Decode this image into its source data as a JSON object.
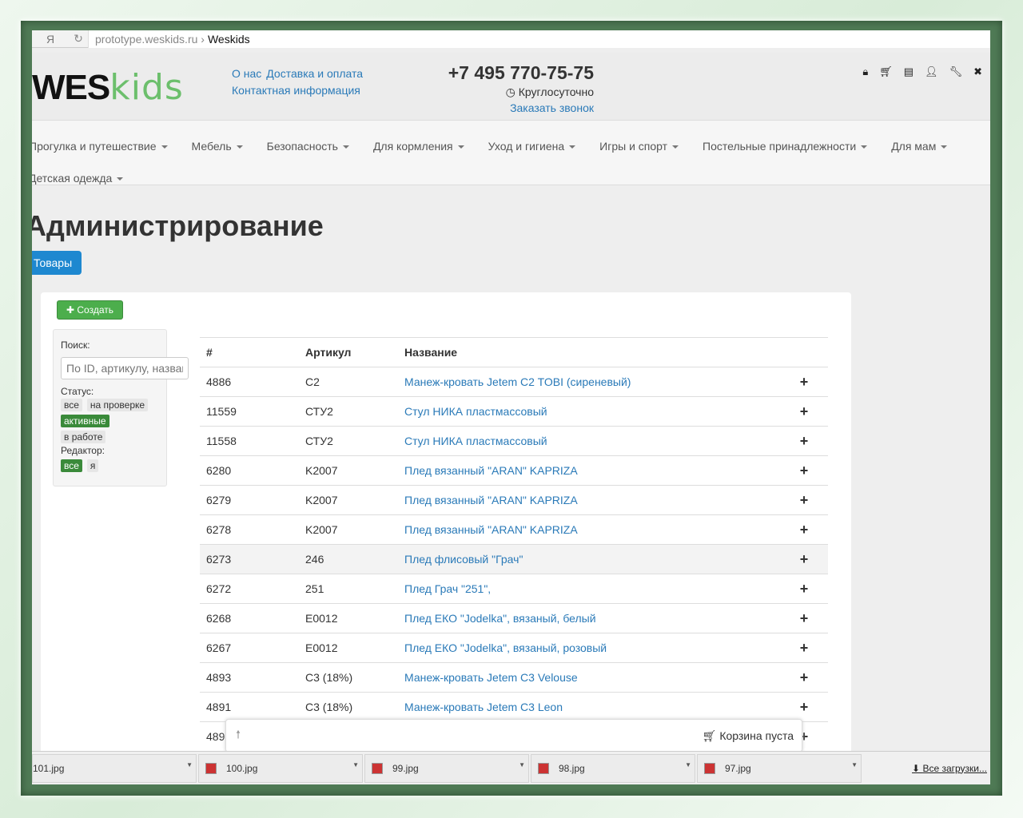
{
  "browser": {
    "ya": "Я",
    "url": "prototype.weskids.ru",
    "title": "Weskids",
    "reload_icon": "reload-icon"
  },
  "header": {
    "logo_a": "WES",
    "logo_b": "kids",
    "links": [
      "О нас",
      "Доставка и оплата",
      "Контактная информация"
    ],
    "phone": "+7 495 770-75-75",
    "hours": "Круглосуточно",
    "callback": "Заказать звонок",
    "icons": [
      "lock-icon",
      "cart-icon",
      "list-icon",
      "user-icon",
      "wrench-icon",
      "close-icon"
    ]
  },
  "nav": {
    "row1": [
      "Прогулка и путешествие",
      "Мебель",
      "Безопасность",
      "Для кормления",
      "Уход и гигиена",
      "Игры и спорт",
      "Постельные принадлежности",
      "Для мам"
    ],
    "row2": [
      "Детская одежда"
    ]
  },
  "page": {
    "title": "Администрирование",
    "tab": "Товары",
    "create": "Создать"
  },
  "filter": {
    "search_label": "Поиск:",
    "search_placeholder": "По ID, артикулу, названию",
    "status_label": "Статус:",
    "status": [
      "все",
      "на проверке",
      "активные",
      "в работе"
    ],
    "status_active": "активные",
    "editor_label": "Редактор:",
    "editor": [
      "все",
      "я"
    ],
    "editor_active": "все"
  },
  "table": {
    "headers": [
      "#",
      "Артикул",
      "Название"
    ],
    "rows": [
      [
        "4886",
        "C2",
        "Манеж-кровать Jetem C2 TOBI (сиреневый)"
      ],
      [
        "11559",
        "СТУ2",
        "Стул НИКА пластмассовый"
      ],
      [
        "11558",
        "СТУ2",
        "Стул НИКА пластмассовый"
      ],
      [
        "6280",
        "K2007",
        "Плед вязанный \"ARAN\" KAPRIZA"
      ],
      [
        "6279",
        "K2007",
        "Плед вязанный \"ARAN\" KAPRIZA"
      ],
      [
        "6278",
        "K2007",
        "Плед вязанный \"ARAN\" KAPRIZA"
      ],
      [
        "6273",
        "246",
        "Плед флисовый \"Грач\""
      ],
      [
        "6272",
        "251",
        "Плед Грач \"251\","
      ],
      [
        "6268",
        "E0012",
        "Плед ЕКО \"Jodelka\", вязаный, белый"
      ],
      [
        "6267",
        "E0012",
        "Плед ЕКО \"Jodelka\", вязаный, розовый"
      ],
      [
        "4893",
        "C3 (18%)",
        "Манеж-кровать Jetem C3 Velouse"
      ],
      [
        "4891",
        "C3 (18%)",
        "Манеж-кровать Jetem C3 Leon"
      ],
      [
        "489",
        "",
        ""
      ]
    ]
  },
  "cart": {
    "text": "Корзина пуста"
  },
  "downloads": {
    "items": [
      "101.jpg",
      "100.jpg",
      "99.jpg",
      "98.jpg",
      "97.jpg"
    ],
    "all": "Все загрузки..."
  }
}
